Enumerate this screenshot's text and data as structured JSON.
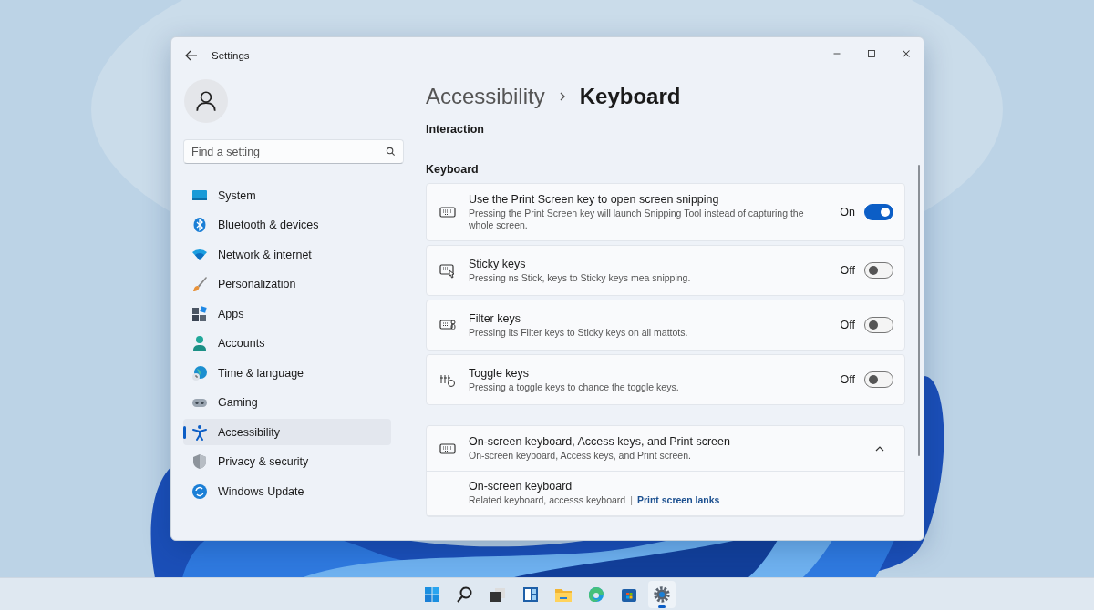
{
  "window": {
    "title": "Settings"
  },
  "search": {
    "placeholder": "Find a setting"
  },
  "nav": [
    {
      "label": "System",
      "selected": false
    },
    {
      "label": "Bluetooth & devices",
      "selected": false
    },
    {
      "label": "Network & internet",
      "selected": false
    },
    {
      "label": "Personalization",
      "selected": false
    },
    {
      "label": "Apps",
      "selected": false
    },
    {
      "label": "Accounts",
      "selected": false
    },
    {
      "label": "Time & language",
      "selected": false
    },
    {
      "label": "Gaming",
      "selected": false
    },
    {
      "label": "Accessibility",
      "selected": true
    },
    {
      "label": "Privacy & security",
      "selected": false
    },
    {
      "label": "Windows Update",
      "selected": false
    }
  ],
  "breadcrumb": {
    "parent": "Accessibility",
    "current": "Keyboard"
  },
  "interaction_heading": "Interaction",
  "keyboard_heading": "Keyboard",
  "settings": [
    {
      "title": "Use the Print Screen key to open screen snipping",
      "description": "Pressing the Print Screen key will launch Snipping Tool instead of capturing the whole screen.",
      "state": "On",
      "on": true
    },
    {
      "title": "Sticky keys",
      "description": "Pressing ns Stick, keys to Sticky keys mea snipping.",
      "state": "Off",
      "on": false
    },
    {
      "title": "Filter keys",
      "description": "Pressing its Filter keys to Sticky keys on all mattots.",
      "state": "Off",
      "on": false
    },
    {
      "title": "Toggle keys",
      "description": "Pressing a toggle keys to chance the toggle keys.",
      "state": "Off",
      "on": false
    }
  ],
  "expander": {
    "title": "On-screen keyboard, Access keys, and Print screen",
    "description": "On-screen keyboard, Access keys, and Print screen.",
    "expanded": true,
    "items": [
      {
        "title": "On-screen keyboard",
        "description": "Related keyboard, accesss keyboard",
        "separator": "|",
        "link": "Print screen lanks"
      }
    ]
  },
  "taskbar": [
    {
      "selected": false
    },
    {
      "selected": false
    },
    {
      "selected": false
    },
    {
      "selected": false
    },
    {
      "selected": false
    },
    {
      "selected": false
    },
    {
      "selected": false
    },
    {
      "selected": true
    }
  ]
}
